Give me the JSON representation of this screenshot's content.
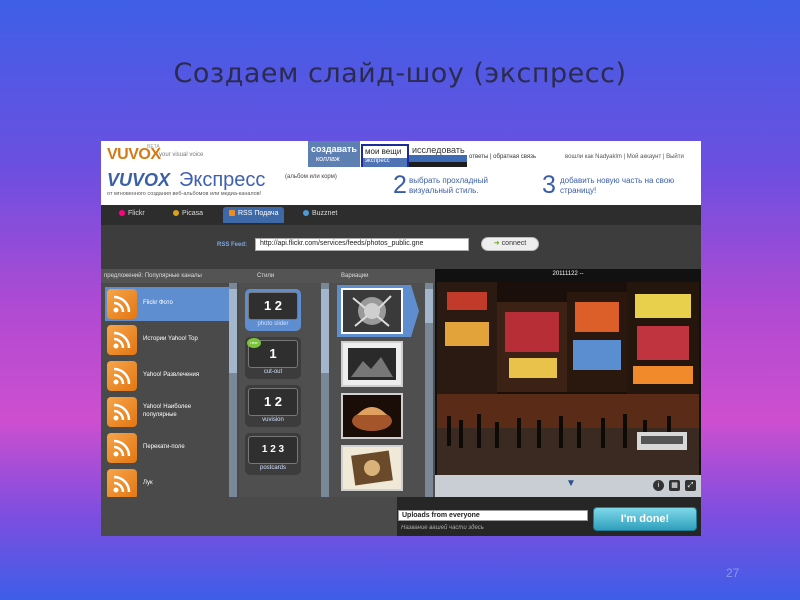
{
  "slide": {
    "title": "Создаем слайд-шоу (экспресс)",
    "page_number": "27"
  },
  "app": {
    "logo": "VUVOX",
    "logo_beta": "BETA",
    "tagline": "your visual voice",
    "tabs": {
      "create": "создавать",
      "create_sub": "коллаж",
      "mine": "мои вещи",
      "mine_sub": "экспресс",
      "explore": "исследовать"
    },
    "header_links": "ответы | обратная связь",
    "header_account": "вошли как  Nadyaklm  |  Мой аккаунт  |  Выйти"
  },
  "steps": {
    "brand": "VUVOX",
    "express": "Экспресс",
    "step1_hint": "(альбом или корм)",
    "step1_sub": "от мгновенного создания веб-альбомов или медиа-каналов!",
    "step2_num": "2",
    "step2_text": "выбрать прохладный визуальный стиль.",
    "step3_num": "3",
    "step3_text": "добавить новую часть на свою страницу!"
  },
  "sources": {
    "flickr": "Flickr",
    "picasa": "Picasa",
    "rss": "RSS Подача",
    "buzznet": "Buzznet"
  },
  "feed": {
    "label": "RSS Feed:",
    "value": "http://api.flickr.com/services/feeds/photos_public.gne",
    "connect": "connect"
  },
  "columns": {
    "channels_header": "предложений: Популярные каналы",
    "styles_header": "Стили",
    "variations_header": "Вариации"
  },
  "channels": [
    "Flickr Фото",
    "Истории Yahoo! Top",
    "Yahoo! Развлечения",
    "Yahoo! Наиболее популярные",
    "Перекати-поле",
    "Лук"
  ],
  "styles": [
    {
      "name": "photo slider",
      "icon": "1 2"
    },
    {
      "name": "cut-out",
      "icon": "1"
    },
    {
      "name": "vuvision",
      "icon": "1 2"
    },
    {
      "name": "postcards",
      "icon": "1 2 3"
    }
  ],
  "preview": {
    "title": "20111122 --"
  },
  "bottom": {
    "title_value": "Uploads from everyone",
    "title_hint": "Название вашей части здесь",
    "done": "I'm done!"
  },
  "colors": {
    "accent": "#5f8ed0",
    "brand_orange": "#d37a16",
    "brand_blue": "#3a60a9",
    "done_button": "#2f9fbd"
  }
}
